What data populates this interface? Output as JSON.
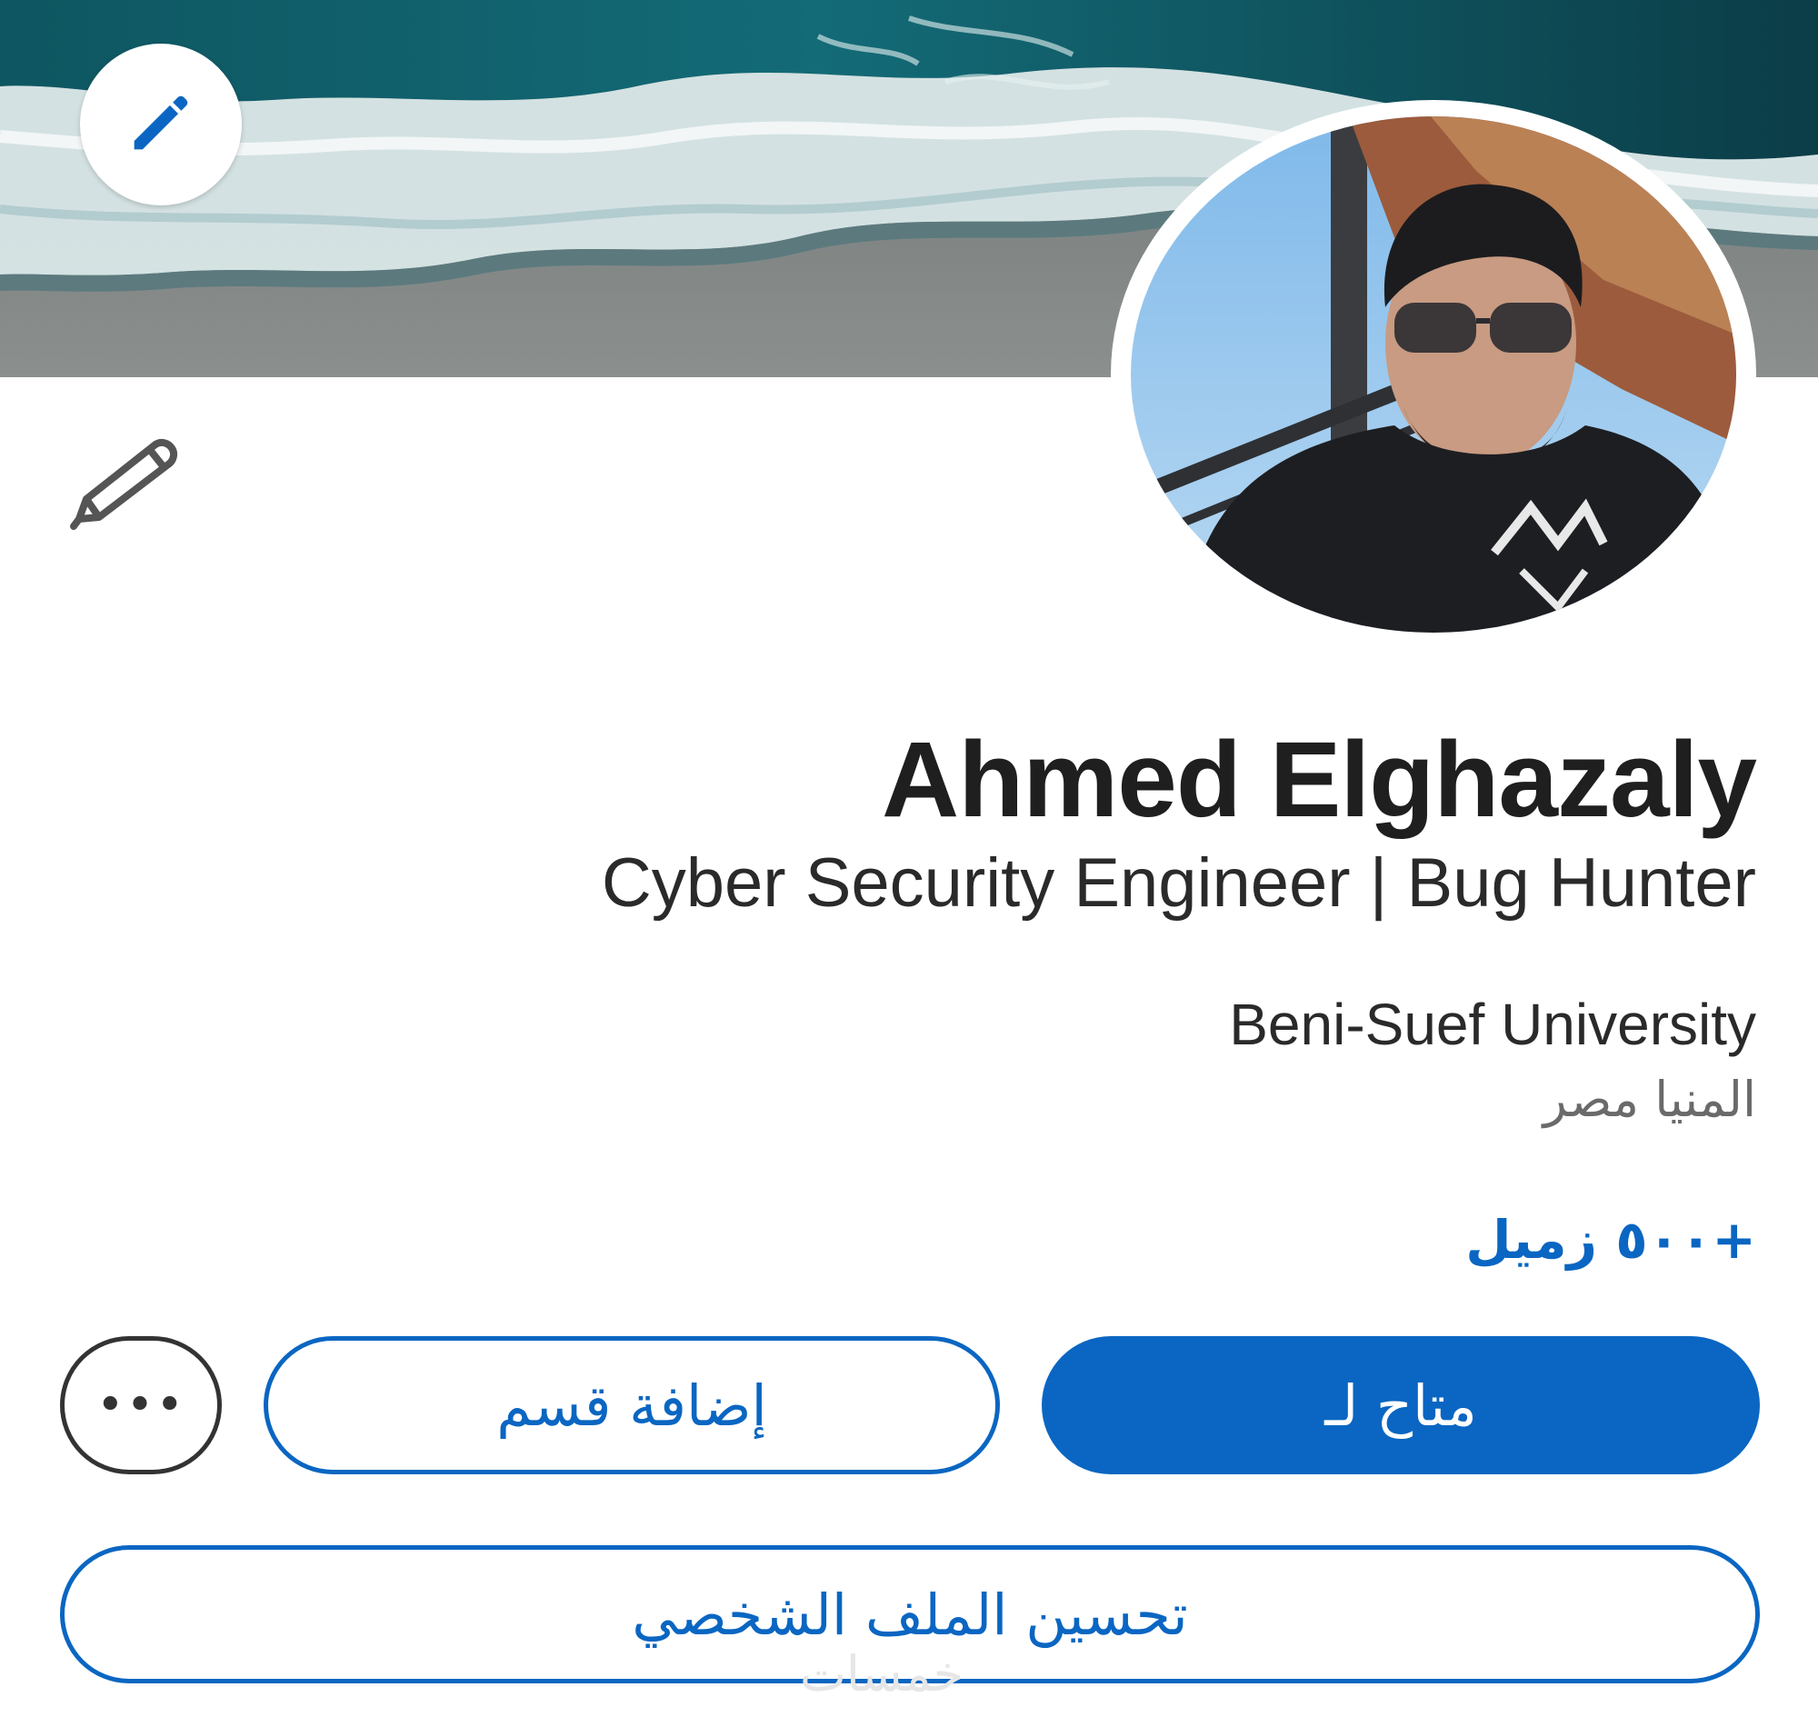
{
  "profile": {
    "name": "Ahmed Elghazaly",
    "headline": "Cyber Security Engineer | Bug Hunter",
    "education": "Beni-Suef University",
    "location": "المنيا مصر",
    "connections": "+٥٠٠ زميل"
  },
  "icons": {
    "cover_edit": "pencil-icon",
    "intro_edit": "pencil-outline-icon",
    "more": "more-dots-icon"
  },
  "actions": {
    "open_to_label": "متاح لـ",
    "add_section_label": "إضافة قسم",
    "more_label": "•••",
    "enhance_profile_label": "تحسين الملف الشخصي"
  },
  "watermark": "خمسات",
  "colors": {
    "accent": "#0a66c2",
    "background": "#ffffff",
    "text_primary": "#1f1f1f",
    "text_secondary": "#6a6a6a"
  }
}
